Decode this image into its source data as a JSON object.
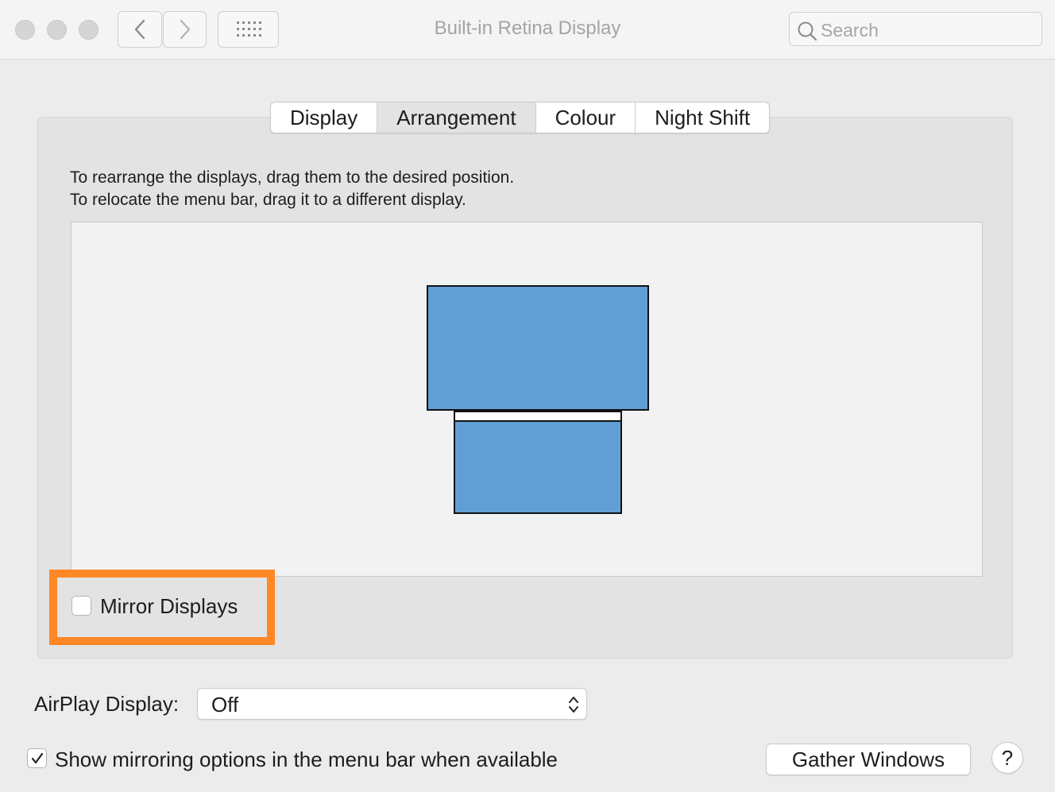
{
  "window": {
    "title": "Built-in Retina Display",
    "search_placeholder": "Search"
  },
  "tabs": [
    {
      "label": "Display",
      "active": false
    },
    {
      "label": "Arrangement",
      "active": true
    },
    {
      "label": "Colour",
      "active": false
    },
    {
      "label": "Night Shift",
      "active": false
    }
  ],
  "arrangement": {
    "instruction_line1": "To rearrange the displays, drag them to the desired position.",
    "instruction_line2": "To relocate the menu bar, drag it to a different display.",
    "display_color": "#629ed6"
  },
  "mirror": {
    "label": "Mirror Displays",
    "checked": false,
    "highlight_color": "#ff8726"
  },
  "airplay": {
    "label": "AirPlay Display:",
    "value": "Off"
  },
  "show_mirroring": {
    "label": "Show mirroring options in the menu bar when available",
    "checked": true
  },
  "gather_windows": {
    "label": "Gather Windows"
  },
  "help": {
    "label": "?"
  }
}
